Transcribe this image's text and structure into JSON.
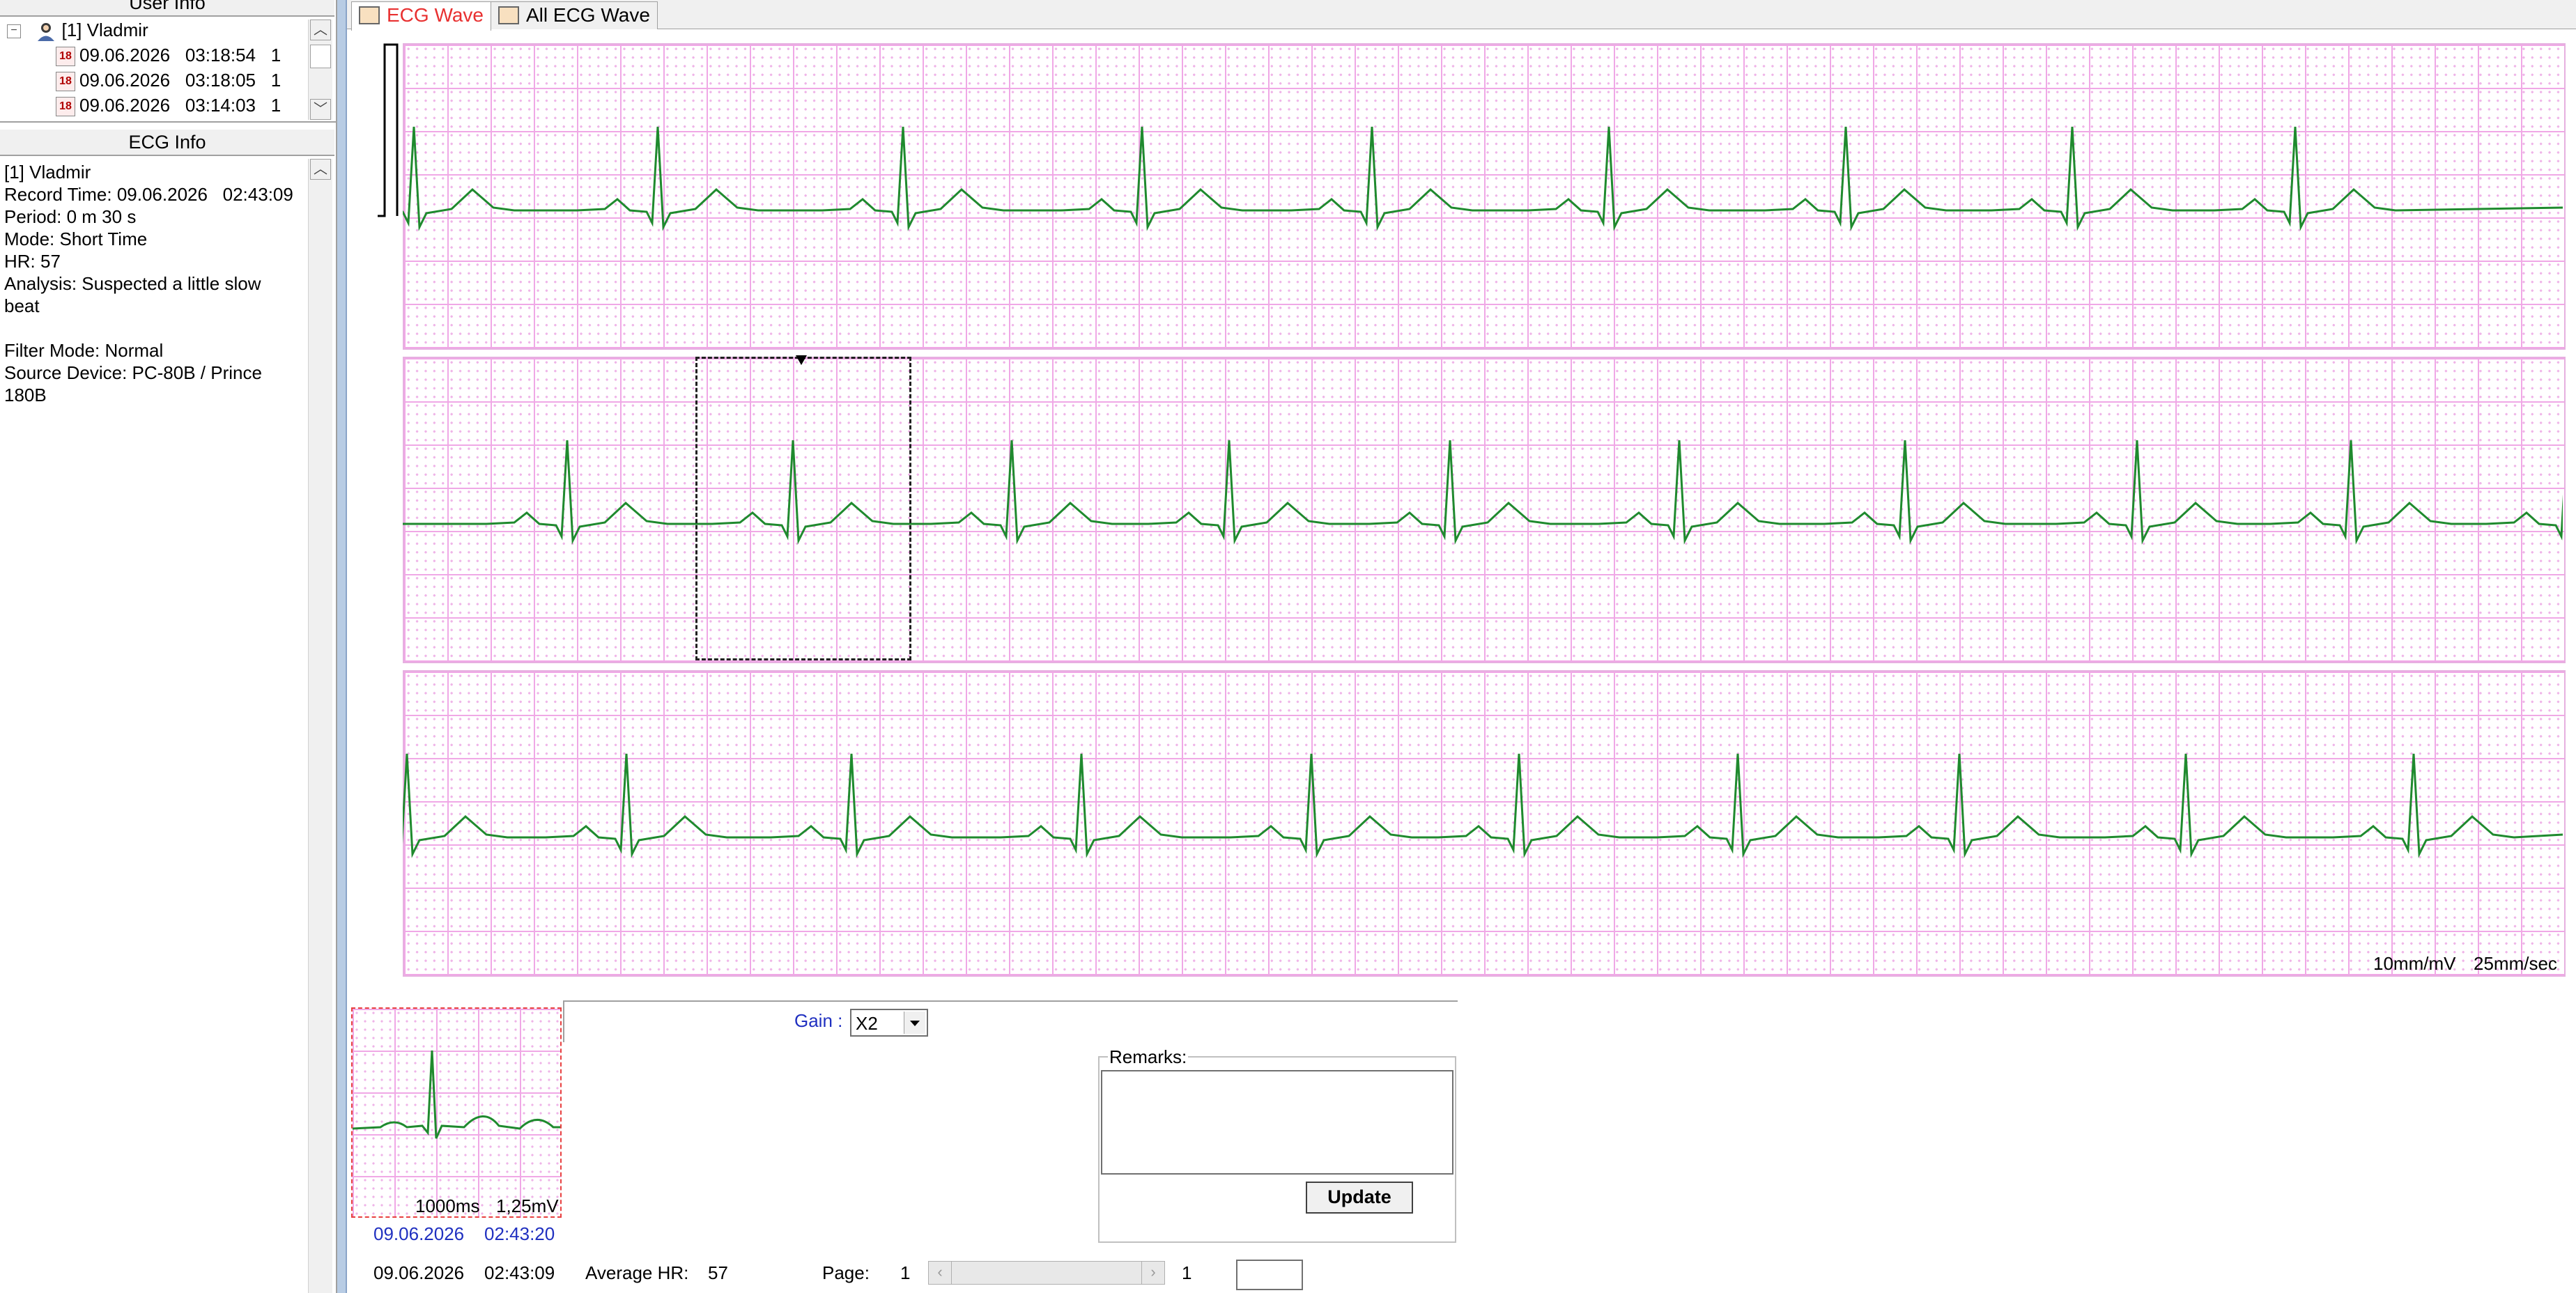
{
  "user_info": {
    "title": "User Info",
    "user": "[1] Vladmir",
    "records": [
      {
        "date": "09.06.2026",
        "time": "03:18:54",
        "num": "1"
      },
      {
        "date": "09.06.2026",
        "time": "03:18:05",
        "num": "1"
      },
      {
        "date": "09.06.2026",
        "time": "03:14:03",
        "num": "1"
      }
    ]
  },
  "ecg_info": {
    "title": "ECG Info",
    "lines": [
      "[1] Vladmir",
      "Record Time: 09.06.2026   02:43:09",
      "Period: 0 m 30 s",
      "Mode: Short Time",
      "HR: 57",
      "Analysis: Suspected a little slow",
      "beat",
      "",
      "Filter Mode: Normal",
      "Source Device: PC-80B / Prince",
      "180B"
    ]
  },
  "tabs": [
    {
      "label": "ECG Wave",
      "active": true
    },
    {
      "label": "All ECG Wave",
      "active": false
    }
  ],
  "wave": {
    "scale_amplitude": "10mm/mV",
    "scale_speed": "25mm/sec",
    "line_color": "#1f8a2e",
    "grid_color": "#f0a8e6"
  },
  "zoom": {
    "scale_time": "1000ms",
    "scale_amp": "1,25mV",
    "timestamp": "09.06.2026    02:43:20"
  },
  "gain": {
    "label": "Gain :",
    "value": "X2"
  },
  "remarks": {
    "label": "Remarks:",
    "value": "",
    "update_label": "Update"
  },
  "status": {
    "record_time": "09.06.2026    02:43:09",
    "avg_hr_label": "Average HR:",
    "avg_hr_value": "57",
    "page_label": "Page:",
    "page_current": "1",
    "page_total": "1"
  },
  "icons": {
    "collapse": "minus-box-icon",
    "user": "user-icon",
    "record": "record-icon",
    "tab": "chart-icon"
  }
}
